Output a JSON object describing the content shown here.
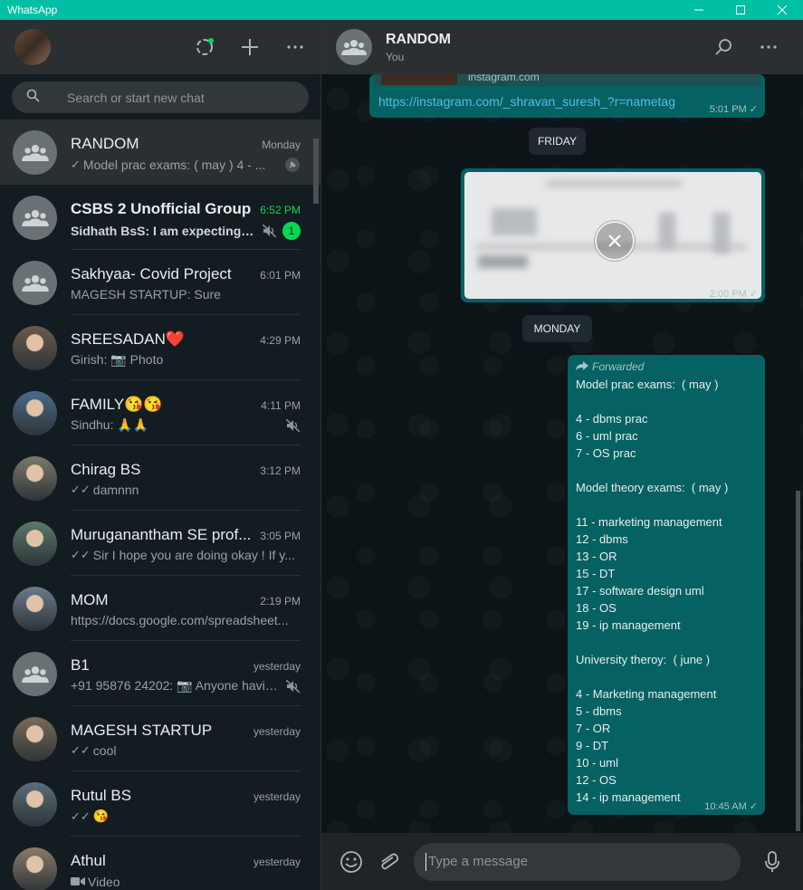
{
  "app": {
    "title": "WhatsApp"
  },
  "colors": {
    "accent": "#00bfa5",
    "bubble_out": "#056162",
    "unread_green": "#06d755",
    "link": "#53bdeb"
  },
  "sidebar": {
    "search_placeholder": "Search or start new chat",
    "chats": [
      {
        "name": "RANDOM",
        "time": "Monday",
        "message": "Model prac exams:  ( may )  4 - ...",
        "ticks": "✓",
        "pinned": true,
        "avatar": "group-icon"
      },
      {
        "name": "CSBS 2 Unofficial Group",
        "time": "6:52 PM",
        "message": "Sidhath BsS: I am expecting ev...",
        "muted": true,
        "unread": "1",
        "bold": true,
        "avatar": "group-icon"
      },
      {
        "name": "Sakhyaa- Covid Project",
        "time": "6:01 PM",
        "message": "MAGESH STARTUP: Sure",
        "avatar": "group-icon"
      },
      {
        "name": "SREESADAN❤️",
        "time": "4:29 PM",
        "message": "Girish: 📷 Photo",
        "avatar": "photo"
      },
      {
        "name": "FAMILY😘😘",
        "time": "4:11 PM",
        "message": "Sindhu: 🙏🙏",
        "muted": true,
        "avatar": "photo"
      },
      {
        "name": "Chirag BS",
        "time": "3:12 PM",
        "message": "damnnn",
        "ticks": "✓✓",
        "avatar": "photo"
      },
      {
        "name": "Muruganantham SE prof...",
        "time": "3:05 PM",
        "message": "Sir I hope you are doing okay !  If y...",
        "ticks": "✓✓",
        "avatar": "photo"
      },
      {
        "name": "MOM",
        "time": "2:19 PM",
        "message": "https://docs.google.com/spreadsheet...",
        "avatar": "photo"
      },
      {
        "name": "B1",
        "time": "yesterday",
        "message": "+91 95876 24202: 📷 Anyone havin...",
        "muted": true,
        "avatar": "group-icon"
      },
      {
        "name": "MAGESH STARTUP",
        "time": "yesterday",
        "message": "cool",
        "ticks": "✓✓",
        "avatar": "photo"
      },
      {
        "name": "Rutul BS",
        "time": "yesterday",
        "message": "😘",
        "ticks": "✓✓",
        "avatar": "photo"
      },
      {
        "name": "Athul",
        "time": "yesterday",
        "message": "Video",
        "video": true,
        "avatar": "photo"
      }
    ]
  },
  "chat": {
    "name": "RANDOM",
    "subtitle": "You",
    "link_preview_domain": "instagram.com",
    "link_message": {
      "url": "https://instagram.com/_shravan_suresh_?r=nametag",
      "time": "5:01 PM ✓"
    },
    "day_friday": "FRIDAY",
    "image_message": {
      "time": "2:00 PM ✓"
    },
    "day_monday": "MONDAY",
    "text_message": {
      "forwarded_label": "Forwarded",
      "lines": [
        "Model prac exams:  ( may )",
        "",
        "4 - dbms prac",
        "6 - uml prac",
        "7 - OS prac",
        "",
        "Model theory exams:  ( may )",
        "",
        "11 - marketing management",
        "12 - dbms",
        "13 - OR",
        "15 - DT",
        "17 - software design uml",
        "18 - OS",
        "19 - ip management",
        "",
        "University theroy:  ( june )",
        "",
        "4 - Marketing management",
        "5 - dbms",
        "7 - OR",
        "9 - DT",
        "10 - uml",
        "12 - OS",
        "14 - ip management"
      ],
      "time": "10:45 AM ✓"
    },
    "composer_placeholder": "Type a message"
  }
}
